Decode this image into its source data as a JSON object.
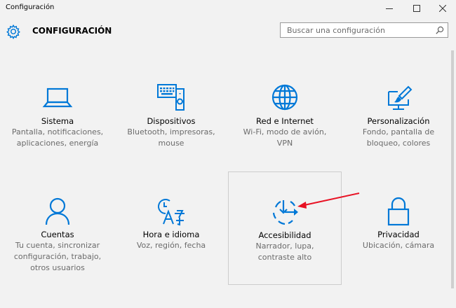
{
  "window": {
    "title": "Configuración",
    "controls": [
      "minimize",
      "maximize",
      "close"
    ]
  },
  "header": {
    "title": "CONFIGURACIÓN",
    "search_placeholder": "Buscar una configuración"
  },
  "colors": {
    "accent": "#0078d7",
    "annotation": "#e81123",
    "background": "#f2f2f2"
  },
  "tiles": [
    {
      "name": "Sistema",
      "description": "Pantalla, notificaciones,\naplicaciones, energía",
      "icon": "laptop-icon"
    },
    {
      "name": "Dispositivos",
      "description": "Bluetooth, impresoras,\nmouse",
      "icon": "devices-icon"
    },
    {
      "name": "Red e Internet",
      "description": "Wi-Fi, modo de avión,\nVPN",
      "icon": "globe-icon"
    },
    {
      "name": "Personalización",
      "description": "Fondo, pantalla de\nbloqueo, colores",
      "icon": "paint-brush-icon"
    },
    {
      "name": "Cuentas",
      "description": "Tu cuenta, sincronizar\nconfiguración, trabajo,\notros usuarios",
      "icon": "person-icon"
    },
    {
      "name": "Hora e idioma",
      "description": "Voz, región, fecha",
      "icon": "time-language-icon"
    },
    {
      "name": "Accesibilidad",
      "description": "Narrador, lupa,\ncontraste alto",
      "icon": "ease-of-access-icon",
      "selected": true
    },
    {
      "name": "Privacidad",
      "description": "Ubicación, cámara",
      "icon": "lock-icon"
    }
  ]
}
